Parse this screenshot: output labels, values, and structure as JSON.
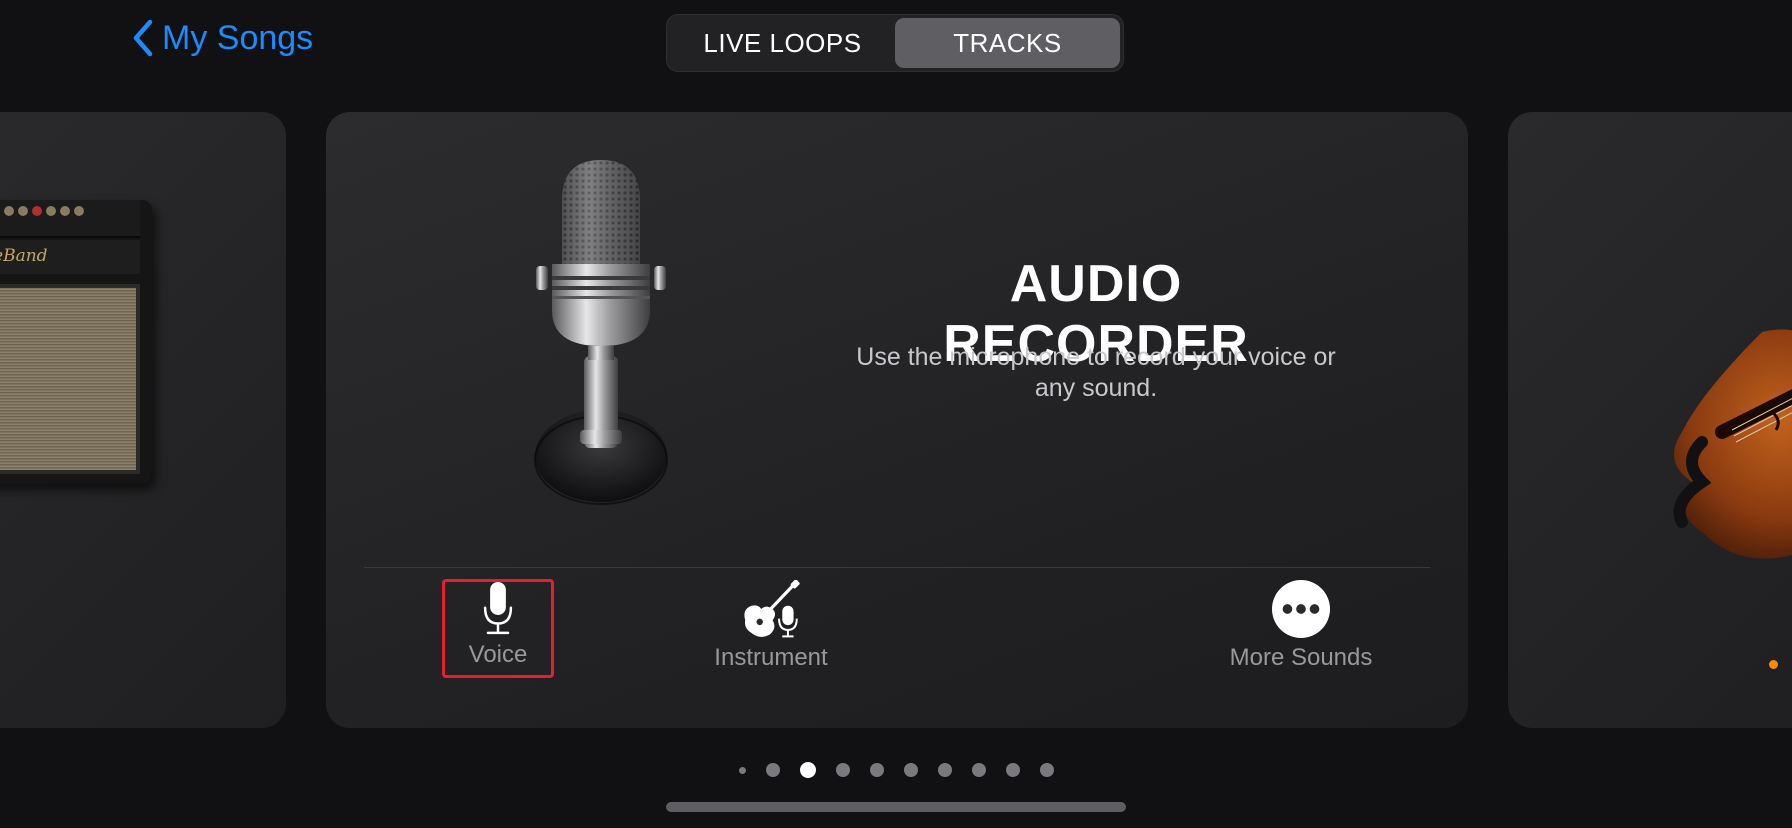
{
  "header": {
    "back_label": "My Songs",
    "tabs": [
      {
        "label": "LIVE LOOPS",
        "selected": false
      },
      {
        "label": "TRACKS",
        "selected": true
      }
    ]
  },
  "left_card": {
    "amp_brand": "ageBand"
  },
  "main_card": {
    "title": "AUDIO RECORDER",
    "description": "Use the microphone to record your voice or any sound.",
    "options": [
      {
        "label": "Voice",
        "icon": "microphone-icon",
        "highlighted": true
      },
      {
        "label": "Instrument",
        "icon": "guitar-mic-icon",
        "highlighted": false
      },
      {
        "label": "More Sounds",
        "icon": "more-icon",
        "highlighted": false
      }
    ]
  },
  "pagination": {
    "total_pages": 10,
    "current_page": 3
  },
  "colors": {
    "accent": "#1a8cff",
    "highlight_border": "#e5202e",
    "orange_indicator": "#ff8a00"
  }
}
